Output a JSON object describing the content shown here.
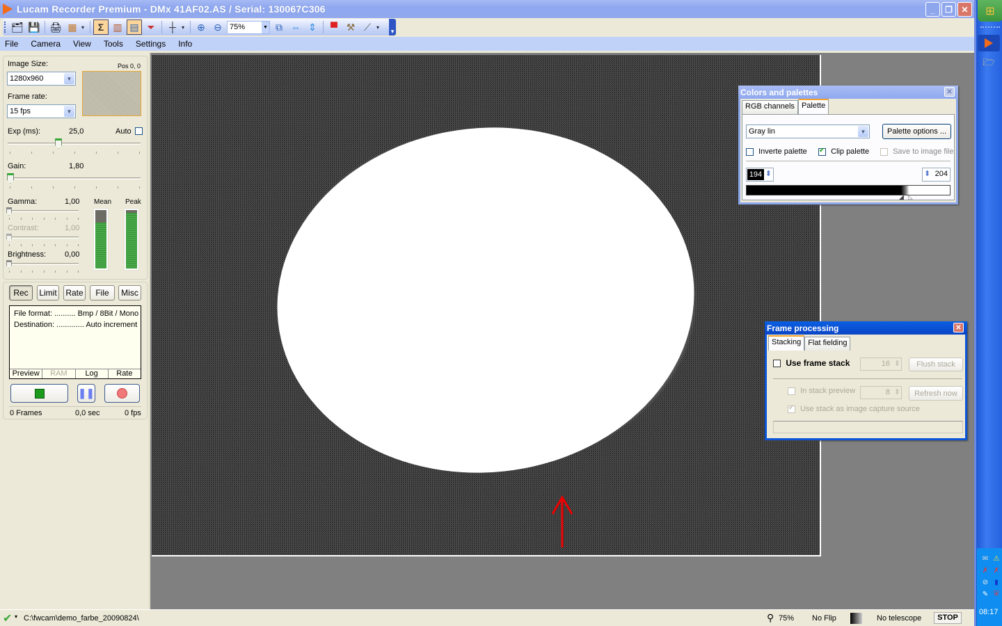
{
  "window": {
    "title": "Lucam Recorder Premium - DMx 41AF02.AS / Serial: 130067C306",
    "controls": [
      "minimize",
      "restore",
      "close"
    ]
  },
  "toolbar": {
    "icons": [
      "open-icon",
      "save-icon",
      "print-icon",
      "color-grid-icon",
      "sum-icon",
      "histogram-icon",
      "grid-view-icon",
      "filter-icon",
      "crosshair-icon",
      "zoom-in-icon",
      "zoom-out-icon",
      "fit-window-icon",
      "fit-width-icon",
      "fit-height-icon",
      "monitor-icon",
      "tools-icon",
      "telescope-icon"
    ],
    "zoom_value": "75%"
  },
  "menu": [
    "File",
    "Camera",
    "View",
    "Tools",
    "Settings",
    "Info"
  ],
  "camera_panel": {
    "image_size_label": "Image Size:",
    "image_size_value": "1280x960",
    "pos_label": "Pos 0, 0",
    "frame_rate_label": "Frame rate:",
    "frame_rate_value": "15 fps",
    "exposure_label": "Exp (ms):",
    "exposure_value": "25,0",
    "auto_label": "Auto",
    "auto_checked": false,
    "gain_label": "Gain:",
    "gain_value": "1,80",
    "gamma_label": "Gamma:",
    "gamma_value": "1,00",
    "contrast_label": "Contrast:",
    "contrast_value": "1,00",
    "brightness_label": "Brightness:",
    "brightness_value": "0,00",
    "mean_label": "Mean",
    "peak_label": "Peak",
    "mean_level": 0.78,
    "peak_level": 0.95
  },
  "record_panel": {
    "tabs": [
      "Rec",
      "Limit",
      "Rate",
      "File",
      "Misc"
    ],
    "active_tab": "Rec",
    "file_format_line": "File format: .......... Bmp / 8Bit / Mono",
    "destination_line": "Destination: ............. Auto increment",
    "info_tabs": [
      "Preview",
      "RAM",
      "Log",
      "Rate"
    ],
    "frames": "0 Frames",
    "seconds": "0,0 sec",
    "fps": "0 fps"
  },
  "colors_palettes": {
    "title": "Colors and palettes",
    "tabs": [
      "RGB channels",
      "Palette"
    ],
    "active_tab": "Palette",
    "palette_value": "Gray lin",
    "palette_options_label": "Palette options ...",
    "invert_label": "Inverte palette",
    "invert_checked": false,
    "clip_label": "Clip palette",
    "clip_checked": true,
    "save_label": "Save to image file",
    "save_checked": false,
    "low_value": "194",
    "high_value": "204"
  },
  "frame_processing": {
    "title": "Frame processing",
    "tabs": [
      "Stacking",
      "Flat fielding"
    ],
    "active_tab": "Stacking",
    "use_stack_label": "Use frame stack",
    "use_stack_checked": false,
    "stack_count": "16",
    "flush_label": "Flush stack",
    "in_stack_preview_label": "In stack preview",
    "preview_count": "8",
    "refresh_label": "Refresh now",
    "capture_source_label": "Use stack as image capture source",
    "capture_source_checked": true
  },
  "statusbar": {
    "path": "C:\\fwcam\\demo_farbe_20090824\\",
    "zoom": "75%",
    "flip": "No Flip",
    "telescope": "No telescope",
    "stop_label": "STOP"
  },
  "taskbar": {
    "clock": "08:17"
  }
}
